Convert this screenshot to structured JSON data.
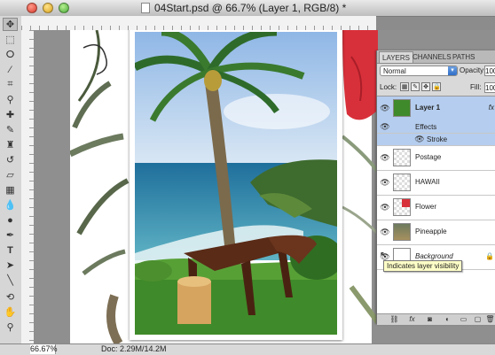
{
  "window": {
    "title": "04Start.psd @ 66.7% (Layer 1, RGB/8) *"
  },
  "toolbox": {
    "tools": [
      "move-tool",
      "marquee-tool",
      "lasso-tool",
      "magic-wand-tool",
      "crop-tool",
      "eyedropper-tool",
      "healing-brush-tool",
      "brush-tool",
      "clone-stamp-tool",
      "history-brush-tool",
      "eraser-tool",
      "gradient-tool",
      "blur-tool",
      "dodge-tool",
      "pen-tool",
      "type-tool",
      "path-selection-tool",
      "shape-tool",
      "hand-tool",
      "zoom-tool"
    ]
  },
  "status": {
    "zoom": "66.67%",
    "doc": "Doc: 2.29M/14.2M"
  },
  "layers_panel": {
    "tabs": [
      "LAYERS",
      "CHANNELS",
      "PATHS"
    ],
    "active_tab": "LAYERS",
    "blend_mode": "Normal",
    "opacity_label": "Opacity:",
    "opacity_value": "100",
    "lock_label": "Lock:",
    "fill_label": "Fill:",
    "fill_value": "100",
    "layers": [
      {
        "name": "Layer 1",
        "selected": true,
        "fx": "fx"
      },
      {
        "name": "Postage",
        "selected": false
      },
      {
        "name": "HAWAII",
        "selected": false
      },
      {
        "name": "Flower",
        "selected": false
      },
      {
        "name": "Pineapple",
        "selected": false
      },
      {
        "name": "Background",
        "selected": false
      }
    ],
    "effects_label": "Effects",
    "stroke_label": "Stroke",
    "tooltip": "Indicates layer visibility"
  },
  "colors": {
    "selection": "#b5cdee",
    "panel_bg": "#d9d9d9",
    "tooltip_bg": "#ffffc8"
  }
}
